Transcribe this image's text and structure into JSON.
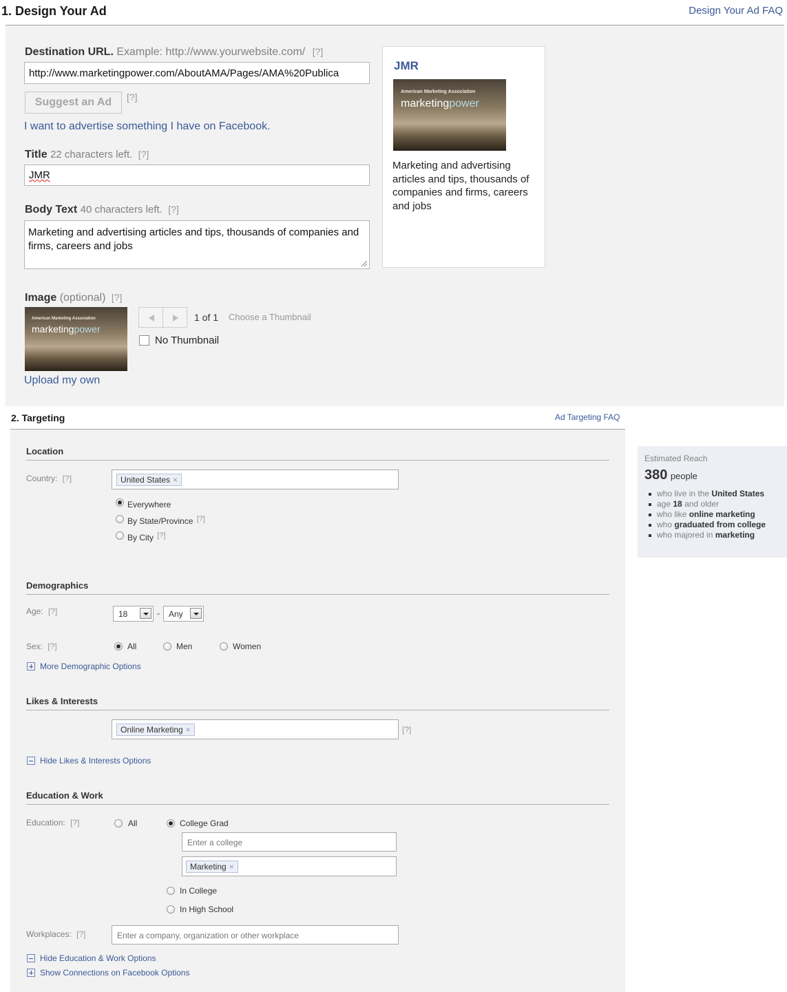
{
  "design": {
    "title": "1. Design Your Ad",
    "faq_link": "Design Your Ad FAQ",
    "destination": {
      "label": "Destination URL.",
      "example": "Example: http://www.yourwebsite.com/",
      "help": "[?]",
      "value": "http://www.marketingpower.com/AboutAMA/Pages/AMA%20Publica"
    },
    "suggest_button": "Suggest an Ad",
    "suggest_help": "[?]",
    "fb_link": "I want to advertise something I have on Facebook.",
    "title_field": {
      "label": "Title",
      "hint": "22 characters left.",
      "help": "[?]",
      "value": "JMR"
    },
    "body_field": {
      "label": "Body Text",
      "hint": "40 characters left.",
      "help": "[?]",
      "value": "Marketing and advertising articles and tips, thousands of companies and firms, careers and jobs"
    },
    "image": {
      "label": "Image",
      "optional": "(optional)",
      "help": "[?]",
      "counter": "1 of 1",
      "choose": "Choose a Thumbnail",
      "no_thumbnail": "No Thumbnail",
      "upload_link": "Upload my own"
    },
    "thumb": {
      "org": "American Marketing Association",
      "brand_a": "marketing",
      "brand_b": "power"
    },
    "preview": {
      "title": "JMR",
      "body": "Marketing and advertising articles and tips, thousands of companies and firms, careers and jobs"
    }
  },
  "targeting": {
    "title": "2. Targeting",
    "faq_link": "Ad Targeting FAQ",
    "location": {
      "heading": "Location",
      "country_label": "Country:",
      "help": "[?]",
      "country_token": "United States",
      "options": [
        "Everywhere",
        "By State/Province",
        "By City"
      ],
      "selected": "Everywhere",
      "help_state": "[?]",
      "help_city": "[?]"
    },
    "demographics": {
      "heading": "Demographics",
      "age_label": "Age:",
      "age_help": "[?]",
      "age_from": "18",
      "age_sep": "-",
      "age_to": "Any",
      "sex_label": "Sex:",
      "sex_help": "[?]",
      "sex_options": [
        "All",
        "Men",
        "Women"
      ],
      "sex_selected": "All",
      "more_link": "More Demographic Options"
    },
    "likes": {
      "heading": "Likes & Interests",
      "token": "Online Marketing",
      "help": "[?]",
      "hide_link": "Hide Likes & Interests Options"
    },
    "education": {
      "heading": "Education & Work",
      "edu_label": "Education:",
      "edu_help": "[?]",
      "opt_all": "All",
      "opt_grad": "College Grad",
      "selected": "College Grad",
      "college_placeholder": "Enter a college",
      "major_token": "Marketing",
      "opt_in_college": "In College",
      "opt_high_school": "In High School",
      "work_label": "Workplaces:",
      "work_help": "[?]",
      "work_placeholder": "Enter a company, organization or other workplace",
      "hide_link": "Hide Education & Work Options",
      "connections_link": "Show Connections on Facebook Options"
    }
  },
  "reach": {
    "label": "Estimated Reach",
    "count": "380",
    "unit": "people",
    "bullets": [
      {
        "pre": "who live in the",
        "bold": "United States",
        "post": ""
      },
      {
        "pre": "age",
        "bold": "18",
        "post": "and older"
      },
      {
        "pre": "who like",
        "bold": "online marketing",
        "post": ""
      },
      {
        "pre": "who",
        "bold": "graduated from college",
        "post": ""
      },
      {
        "pre": "who majored in",
        "bold": "marketing",
        "post": ""
      }
    ]
  },
  "colors": {
    "link": "#3b5998",
    "panel": "#f2f2f2",
    "reach_bg": "#edeff4"
  }
}
